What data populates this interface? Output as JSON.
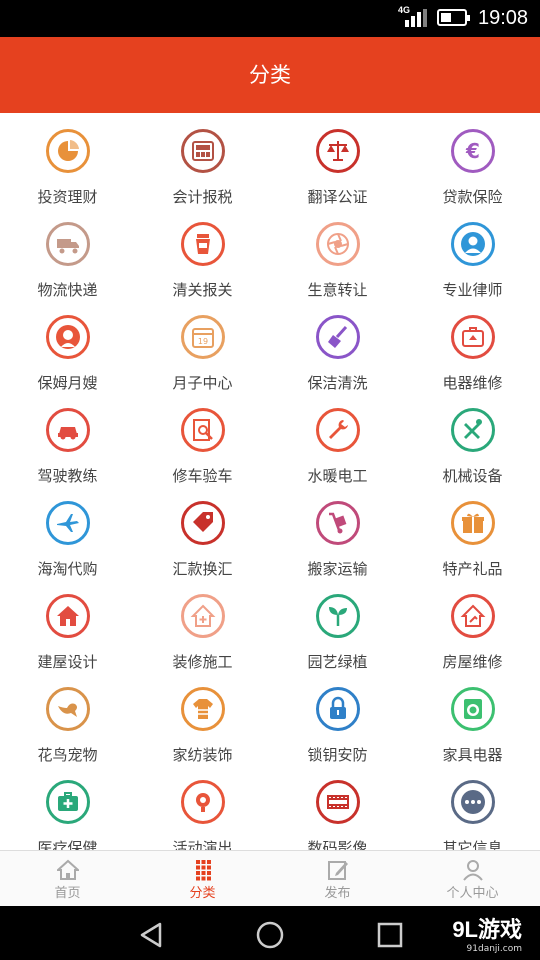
{
  "status_bar": {
    "network": "4G",
    "time": "19:08"
  },
  "header": {
    "title": "分类"
  },
  "categories": [
    {
      "label": "投资理财",
      "icon": "pie-chart-icon",
      "color": "#e8913a"
    },
    {
      "label": "会计报税",
      "icon": "calculator-icon",
      "color": "#b35244"
    },
    {
      "label": "翻译公证",
      "icon": "scales-icon",
      "color": "#c8312b"
    },
    {
      "label": "贷款保险",
      "icon": "euro-icon",
      "color": "#a05bc0"
    },
    {
      "label": "物流快递",
      "icon": "truck-icon",
      "color": "#c49a8a"
    },
    {
      "label": "清关报关",
      "icon": "cup-icon",
      "color": "#e8553a"
    },
    {
      "label": "生意转让",
      "icon": "aperture-icon",
      "color": "#f0a088"
    },
    {
      "label": "专业律师",
      "icon": "lawyer-icon",
      "color": "#2f96d8"
    },
    {
      "label": "保姆月嫂",
      "icon": "nanny-icon",
      "color": "#e8553a"
    },
    {
      "label": "月子中心",
      "icon": "calendar-icon",
      "color": "#e8a060"
    },
    {
      "label": "保洁清洗",
      "icon": "broom-icon",
      "color": "#8a55c8"
    },
    {
      "label": "电器维修",
      "icon": "toolbox-icon",
      "color": "#e24c40"
    },
    {
      "label": "驾驶教练",
      "icon": "car-icon",
      "color": "#e24c40"
    },
    {
      "label": "修车验车",
      "icon": "inspection-icon",
      "color": "#e8553a"
    },
    {
      "label": "水暖电工",
      "icon": "wrench-icon",
      "color": "#e8553a"
    },
    {
      "label": "机械设备",
      "icon": "tools-icon",
      "color": "#2aa87a"
    },
    {
      "label": "海淘代购",
      "icon": "airplane-icon",
      "color": "#2f96d8"
    },
    {
      "label": "汇款换汇",
      "icon": "price-tag-icon",
      "color": "#c8312b"
    },
    {
      "label": "搬家运输",
      "icon": "hand-truck-icon",
      "color": "#c04a7a"
    },
    {
      "label": "特产礼品",
      "icon": "gift-icon",
      "color": "#e8913a"
    },
    {
      "label": "建屋设计",
      "icon": "house-icon",
      "color": "#e24c40"
    },
    {
      "label": "装修施工",
      "icon": "house-plus-icon",
      "color": "#f0a088"
    },
    {
      "label": "园艺绿植",
      "icon": "sprout-icon",
      "color": "#2aa87a"
    },
    {
      "label": "房屋维修",
      "icon": "house-repair-icon",
      "color": "#e24c40"
    },
    {
      "label": "花鸟宠物",
      "icon": "bird-icon",
      "color": "#d9934a"
    },
    {
      "label": "家纺装饰",
      "icon": "shirt-icon",
      "color": "#e8913a"
    },
    {
      "label": "锁钥安防",
      "icon": "lock-icon",
      "color": "#2f80c8"
    },
    {
      "label": "家具电器",
      "icon": "washing-machine-icon",
      "color": "#3cc070"
    },
    {
      "label": "医疗保健",
      "icon": "first-aid-icon",
      "color": "#2aa87a"
    },
    {
      "label": "活动演出",
      "icon": "microphone-icon",
      "color": "#e8553a"
    },
    {
      "label": "数码影像",
      "icon": "film-icon",
      "color": "#c8312b"
    },
    {
      "label": "其它信息",
      "icon": "more-icon",
      "color": "#5a6a86"
    }
  ],
  "tab_bar": [
    {
      "label": "首页",
      "icon": "home-icon",
      "active": false
    },
    {
      "label": "分类",
      "icon": "grid-icon",
      "active": true
    },
    {
      "label": "发布",
      "icon": "edit-icon",
      "active": false
    },
    {
      "label": "个人中心",
      "icon": "user-icon",
      "active": false
    }
  ],
  "watermark": {
    "brand": "9L游戏",
    "site": "91danji.com"
  },
  "colors": {
    "accent": "#e5411f"
  }
}
